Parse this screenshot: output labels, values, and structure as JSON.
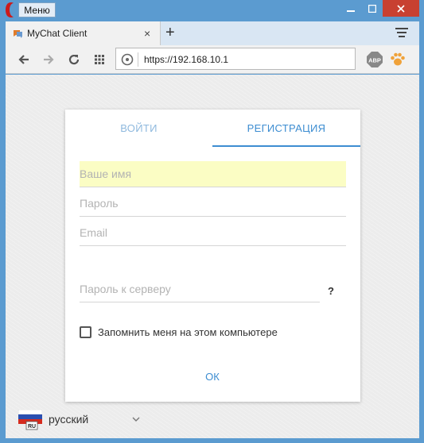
{
  "window": {
    "menu_label": "Меню",
    "controls": {
      "minimize": "minimize",
      "maximize": "maximize",
      "close": "close"
    }
  },
  "tab": {
    "title": "MyChat Client",
    "close": "×",
    "new_tab": "+"
  },
  "toolbar": {
    "url": "https://192.168.10.1",
    "extensions": {
      "adblock": "ABP"
    }
  },
  "login": {
    "tab_login": "ВОЙТИ",
    "tab_register": "РЕГИСТРАЦИЯ",
    "fields": {
      "name_placeholder": "Ваше имя",
      "password_placeholder": "Пароль",
      "email_placeholder": "Email",
      "server_password_placeholder": "Пароль к серверу"
    },
    "help": "?",
    "remember_label": "Запомнить меня на этом компьютере",
    "ok_label": "ОК"
  },
  "language": {
    "label": "русский",
    "flag_code": "RU"
  },
  "colors": {
    "accent": "#3d8dd1",
    "accent_inactive": "#8fb9de",
    "autofill": "#fbfdc4",
    "window_frame": "#5b9bd0",
    "close_button": "#c84031"
  }
}
